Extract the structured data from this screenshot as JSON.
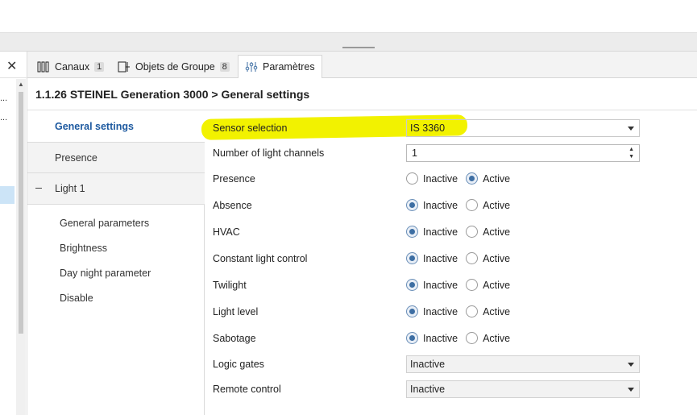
{
  "tabs": [
    {
      "label": "Canaux",
      "badge": "1",
      "icon": "channels-icon"
    },
    {
      "label": "Objets de Groupe",
      "badge": "8",
      "icon": "group-objects-icon"
    },
    {
      "label": "Paramètres",
      "icon": "parameters-icon",
      "active": true
    }
  ],
  "left": {
    "items": [
      "...",
      "..."
    ]
  },
  "header": {
    "title": "1.1.26 STEINEL Generation 3000 > General settings"
  },
  "nav": {
    "general_settings": "General settings",
    "presence": "Presence",
    "light1": "Light 1",
    "sub": [
      "General parameters",
      "Brightness",
      "Day night parameter",
      "Disable"
    ]
  },
  "form": {
    "sensor_selection": {
      "label": "Sensor selection",
      "value": "IS 3360"
    },
    "light_channels": {
      "label": "Number of light channels",
      "value": "1"
    },
    "radios": [
      {
        "label": "Presence",
        "selected": "Active"
      },
      {
        "label": "Absence",
        "selected": "Inactive"
      },
      {
        "label": "HVAC",
        "selected": "Inactive"
      },
      {
        "label": "Constant light control",
        "selected": "Inactive"
      },
      {
        "label": "Twilight",
        "selected": "Inactive"
      },
      {
        "label": "Light level",
        "selected": "Inactive"
      },
      {
        "label": "Sabotage",
        "selected": "Inactive"
      }
    ],
    "option_inactive": "Inactive",
    "option_active": "Active",
    "logic_gates": {
      "label": "Logic gates",
      "value": "Inactive"
    },
    "remote_control": {
      "label": "Remote control",
      "value": "Inactive"
    }
  },
  "colors": {
    "highlight": "#f2f200",
    "accent": "#1e5aa0"
  }
}
